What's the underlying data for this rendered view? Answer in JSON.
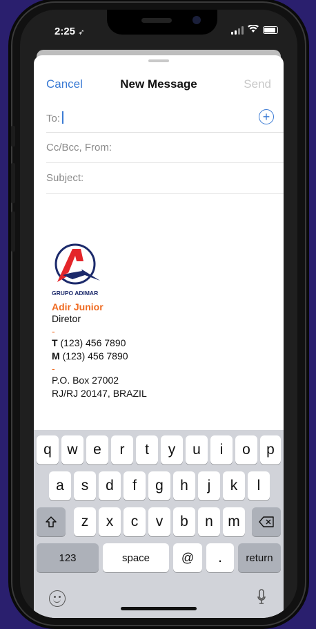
{
  "status_bar": {
    "time": "2:25"
  },
  "compose": {
    "cancel_label": "Cancel",
    "title": "New Message",
    "send_label": "Send",
    "to_label": "To:",
    "cc_label": "Cc/Bcc, From:",
    "subject_label": "Subject:"
  },
  "signature": {
    "brand": "GRUPO ADIMAR",
    "name": "Adir Junior",
    "role": "Diretor",
    "dash": "-",
    "phone_t_prefix": "T",
    "phone_t": "(123) 456 7890",
    "phone_m_prefix": "M",
    "phone_m": "(123) 456 7890",
    "address_line1": "P.O. Box 27002",
    "address_line2": "RJ/RJ 20147, BRAZIL",
    "logo_colors": {
      "red": "#e4262a",
      "navy": "#1c2a6b"
    },
    "name_color": "#ef6b22"
  },
  "keyboard": {
    "row1": [
      "q",
      "w",
      "e",
      "r",
      "t",
      "y",
      "u",
      "i",
      "o",
      "p"
    ],
    "row2": [
      "a",
      "s",
      "d",
      "f",
      "g",
      "h",
      "j",
      "k",
      "l"
    ],
    "row3": [
      "z",
      "x",
      "c",
      "v",
      "b",
      "n",
      "m"
    ],
    "numbers_label": "123",
    "space_label": "space",
    "at_label": "@",
    "dot_label": ".",
    "return_label": "return"
  },
  "colors": {
    "accent": "#3b7bd4",
    "background": "#2a1f6e"
  }
}
